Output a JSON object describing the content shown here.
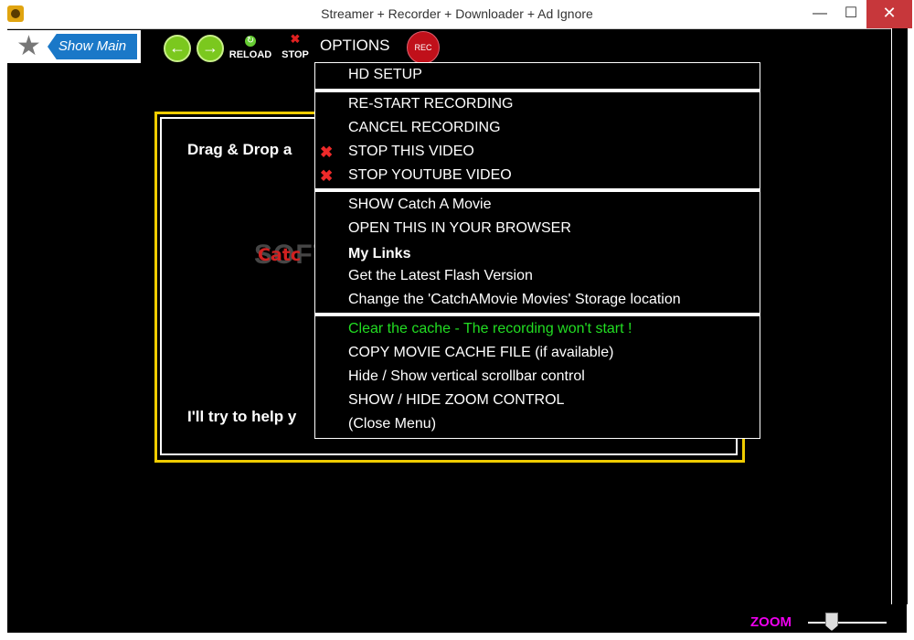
{
  "window": {
    "title": "Streamer + Recorder + Downloader + Ad Ignore",
    "minimize_glyph": "—",
    "maximize_glyph": "☐",
    "close_glyph": "✕"
  },
  "toolbar": {
    "show_main": "Show Main",
    "back_glyph": "←",
    "forward_glyph": "→",
    "reload_label": "RELOAD",
    "stop_label": "STOP",
    "options_label": "OPTIONS",
    "rec_label": "REC"
  },
  "panel": {
    "drag_text": "Drag & Drop a",
    "catch_text": "Catc",
    "help_text": "I'll try to help y"
  },
  "watermark": "SOFTPEDIA",
  "menu": {
    "items": [
      {
        "label": "HD SETUP"
      },
      {
        "label": "RE-START RECORDING"
      },
      {
        "label": "CANCEL RECORDING"
      },
      {
        "label": "STOP THIS VIDEO",
        "icon": "close-x-icon"
      },
      {
        "label": "STOP YOUTUBE VIDEO",
        "icon": "close-x-icon"
      },
      {
        "label": "SHOW Catch A Movie"
      },
      {
        "label": "OPEN THIS IN YOUR BROWSER"
      },
      {
        "label": "My Links"
      },
      {
        "label": "Get the Latest Flash Version"
      },
      {
        "label": "Change the 'CatchAMovie Movies' Storage location"
      },
      {
        "label": "Clear the cache - The recording won't start !"
      },
      {
        "label": "COPY MOVIE CACHE FILE (if available)"
      },
      {
        "label": "Hide / Show  vertical scrollbar control"
      },
      {
        "label": "SHOW / HIDE ZOOM CONTROL"
      },
      {
        "label": "(Close Menu)"
      }
    ],
    "x_glyph": "✖"
  },
  "zoom": {
    "label": "ZOOM",
    "level": 0.25
  },
  "colors": {
    "background": "#000000",
    "panel_border": "#f0cc00",
    "green_item": "#22dd22",
    "zoom_label": "#ee00ee",
    "rec_button": "#c0101a"
  }
}
